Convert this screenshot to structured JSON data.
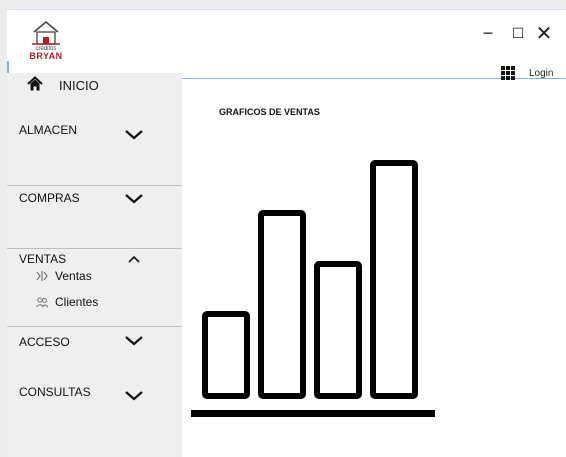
{
  "app": {
    "logo_small": "créditos",
    "logo_big": "BRYAN"
  },
  "window_controls": {
    "minimize": "−",
    "maximize": "☐",
    "close": "✕"
  },
  "header": {
    "login_label": "Login",
    "grid_icon": "grid-icon"
  },
  "sidebar": {
    "inicio": "INICIO",
    "sections": [
      {
        "label": "ALMACEN",
        "expanded": false
      },
      {
        "label": "COMPRAS",
        "expanded": false
      },
      {
        "label": "VENTAS",
        "expanded": true,
        "items": [
          {
            "label": "Ventas",
            "icon": "ventas-icon"
          },
          {
            "label": "Clientes",
            "icon": "clientes-icon"
          }
        ]
      },
      {
        "label": "ACCESO",
        "expanded": false
      },
      {
        "label": "CONSULTAS",
        "expanded": false
      }
    ]
  },
  "main": {
    "title": "GRAFICOS DE VENTAS",
    "illustration_icon": "bar-chart-icon"
  },
  "colors": {
    "accent_line": "#7fb2e6",
    "logo_red": "#b21f24",
    "sidebar_bg": "#efefef"
  }
}
